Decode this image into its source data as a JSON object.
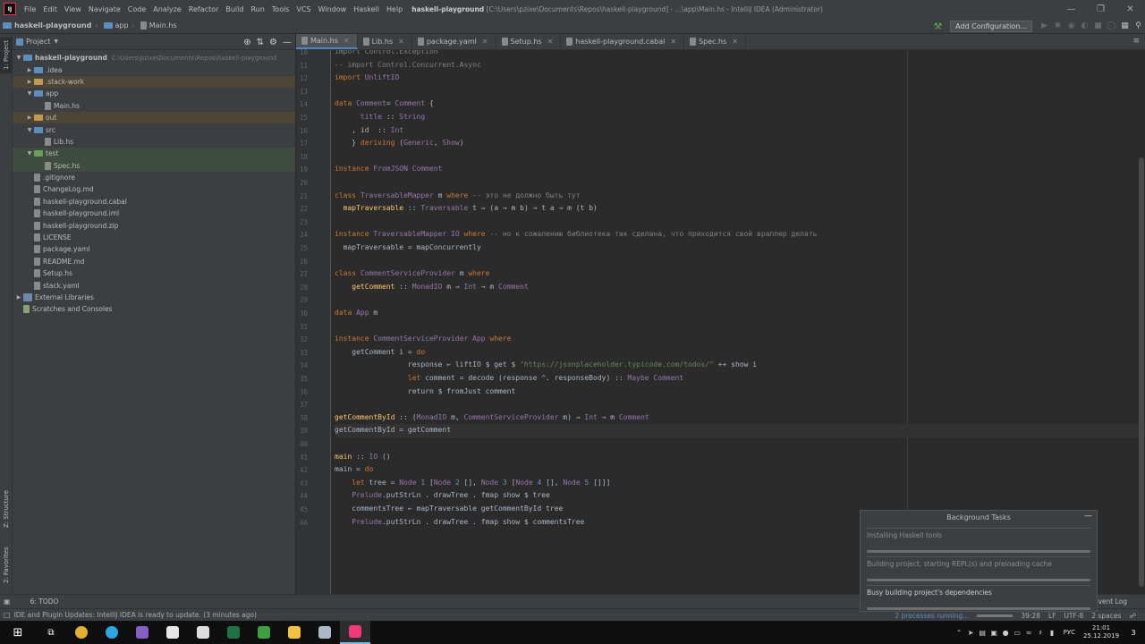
{
  "window": {
    "menu": [
      "File",
      "Edit",
      "View",
      "Navigate",
      "Code",
      "Analyze",
      "Refactor",
      "Build",
      "Run",
      "Tools",
      "VCS",
      "Window",
      "Haskell",
      "Help"
    ],
    "title_bold": "haskell-playground",
    "title_rest": "[C:\\Users\\pzixe\\Documents\\Repos\\haskell-playground] - ...\\app\\Main.hs - IntelliJ IDEA (Administrator)"
  },
  "navbar": {
    "crumbs": [
      "haskell-playground",
      "app",
      "Main.hs"
    ],
    "add_configuration": "Add Configuration..."
  },
  "side_tabs": {
    "project": "1: Project",
    "structure": "Z: Structure",
    "favorites": "2: Favorites"
  },
  "project": {
    "header": "Project",
    "root": {
      "name": "haskell-playground",
      "path": "C:\\Users\\pzixe\\Documents\\Repos\\haskell-playground"
    },
    "items": [
      {
        "label": ".idea",
        "indent": 1,
        "type": "folder",
        "arrow": "▶",
        "style": ""
      },
      {
        "label": ".stack-work",
        "indent": 1,
        "type": "folder",
        "arrow": "▶",
        "style": "excl"
      },
      {
        "label": "app",
        "indent": 1,
        "type": "folder",
        "arrow": "▼",
        "style": ""
      },
      {
        "label": "Main.hs",
        "indent": 2,
        "type": "file",
        "arrow": "",
        "style": ""
      },
      {
        "label": "out",
        "indent": 1,
        "type": "folder",
        "arrow": "▶",
        "style": "excl"
      },
      {
        "label": "src",
        "indent": 1,
        "type": "folder",
        "arrow": "▼",
        "style": ""
      },
      {
        "label": "Lib.hs",
        "indent": 2,
        "type": "file",
        "arrow": "",
        "style": ""
      },
      {
        "label": "test",
        "indent": 1,
        "type": "folder",
        "arrow": "▼",
        "style": "testsrc"
      },
      {
        "label": "Spec.hs",
        "indent": 2,
        "type": "file",
        "arrow": "",
        "style": "testsrc"
      },
      {
        "label": ".gitignore",
        "indent": 1,
        "type": "file",
        "arrow": "",
        "style": ""
      },
      {
        "label": "ChangeLog.md",
        "indent": 1,
        "type": "file",
        "arrow": "",
        "style": ""
      },
      {
        "label": "haskell-playground.cabal",
        "indent": 1,
        "type": "file",
        "arrow": "",
        "style": ""
      },
      {
        "label": "haskell-playground.iml",
        "indent": 1,
        "type": "file",
        "arrow": "",
        "style": ""
      },
      {
        "label": "haskell-playground.zip",
        "indent": 1,
        "type": "file",
        "arrow": "",
        "style": ""
      },
      {
        "label": "LICENSE",
        "indent": 1,
        "type": "file",
        "arrow": "",
        "style": ""
      },
      {
        "label": "package.yaml",
        "indent": 1,
        "type": "file",
        "arrow": "",
        "style": ""
      },
      {
        "label": "README.md",
        "indent": 1,
        "type": "file",
        "arrow": "",
        "style": ""
      },
      {
        "label": "Setup.hs",
        "indent": 1,
        "type": "file",
        "arrow": "",
        "style": ""
      },
      {
        "label": "stack.yaml",
        "indent": 1,
        "type": "file",
        "arrow": "",
        "style": ""
      },
      {
        "label": "External Libraries",
        "indent": 0,
        "type": "lib",
        "arrow": "▶",
        "style": ""
      },
      {
        "label": "Scratches and Consoles",
        "indent": 0,
        "type": "scratch",
        "arrow": "",
        "style": ""
      }
    ]
  },
  "tabs": [
    {
      "label": "Main.hs",
      "active": true
    },
    {
      "label": "Lib.hs",
      "active": false
    },
    {
      "label": "package.yaml",
      "active": false
    },
    {
      "label": "Setup.hs",
      "active": false
    },
    {
      "label": "haskell-playground.cabal",
      "active": false
    },
    {
      "label": "Spec.hs",
      "active": false
    }
  ],
  "code": [
    {
      "n": "10",
      "t": [
        [
          "cm",
          "import Control.Exception"
        ]
      ]
    },
    {
      "n": "11",
      "t": [
        [
          "cm",
          "-- import Control.Concurrent.Async"
        ]
      ]
    },
    {
      "n": "12",
      "t": [
        [
          "kw",
          "import "
        ],
        [
          "ty",
          "UnliftIO"
        ]
      ]
    },
    {
      "n": "13",
      "t": []
    },
    {
      "n": "14",
      "t": [
        [
          "kw",
          "data "
        ],
        [
          "ty",
          "Comment"
        ],
        [
          "",
          "= "
        ],
        [
          "ty",
          "Comment"
        ],
        [
          "",
          " {"
        ]
      ]
    },
    {
      "n": "15",
      "t": [
        [
          "",
          "      "
        ],
        [
          "ty",
          "title"
        ],
        [
          "",
          " :: "
        ],
        [
          "ty",
          "String"
        ]
      ]
    },
    {
      "n": "16",
      "t": [
        [
          "",
          "    , id  :: "
        ],
        [
          "ty",
          "Int"
        ]
      ]
    },
    {
      "n": "17",
      "t": [
        [
          "",
          "    } "
        ],
        [
          "kw",
          "deriving "
        ],
        [
          "",
          "("
        ],
        [
          "ty",
          "Generic"
        ],
        [
          "",
          ", "
        ],
        [
          "ty",
          "Show"
        ],
        [
          "",
          ")"
        ]
      ]
    },
    {
      "n": "18",
      "t": []
    },
    {
      "n": "19",
      "t": [
        [
          "kw",
          "instance "
        ],
        [
          "ty",
          "FromJSON Comment"
        ]
      ]
    },
    {
      "n": "20",
      "t": []
    },
    {
      "n": "21",
      "t": [
        [
          "kw",
          "class "
        ],
        [
          "ty",
          "TraversableMapper"
        ],
        [
          "",
          " m "
        ],
        [
          "kw",
          "where "
        ],
        [
          "cm",
          "-- это не должно быть тут"
        ]
      ]
    },
    {
      "n": "22",
      "t": [
        [
          "",
          "  "
        ],
        [
          "fn",
          "mapTraversable"
        ],
        [
          "",
          " :: "
        ],
        [
          "ty",
          "Traversable"
        ],
        [
          "",
          " t ⇒ (a → m b) → t a → m (t b)"
        ]
      ]
    },
    {
      "n": "23",
      "t": []
    },
    {
      "n": "24",
      "t": [
        [
          "kw",
          "instance "
        ],
        [
          "ty",
          "TraversableMapper IO"
        ],
        [
          "kw",
          " where "
        ],
        [
          "cm",
          "-- но к сожалению библиотека так сделана, что приходится свой враппер делать"
        ]
      ]
    },
    {
      "n": "25",
      "t": [
        [
          "",
          "  mapTraversable = mapConcurrently"
        ]
      ]
    },
    {
      "n": "26",
      "t": []
    },
    {
      "n": "27",
      "t": [
        [
          "kw",
          "class "
        ],
        [
          "ty",
          "CommentServiceProvider"
        ],
        [
          "",
          " m "
        ],
        [
          "kw",
          "where"
        ]
      ]
    },
    {
      "n": "28",
      "t": [
        [
          "",
          "    "
        ],
        [
          "fn",
          "getComment"
        ],
        [
          "",
          " :: "
        ],
        [
          "ty",
          "MonadIO"
        ],
        [
          "",
          " m ⇒ "
        ],
        [
          "ty",
          "Int"
        ],
        [
          "",
          " → m "
        ],
        [
          "ty",
          "Comment"
        ]
      ]
    },
    {
      "n": "29",
      "t": []
    },
    {
      "n": "30",
      "t": [
        [
          "kw",
          "data "
        ],
        [
          "ty",
          "App"
        ],
        [
          "",
          " m"
        ]
      ]
    },
    {
      "n": "31",
      "t": []
    },
    {
      "n": "32",
      "t": [
        [
          "kw",
          "instance "
        ],
        [
          "ty",
          "CommentServiceProvider App"
        ],
        [
          "kw",
          " where"
        ]
      ]
    },
    {
      "n": "33",
      "t": [
        [
          "",
          "    getComment i = "
        ],
        [
          "kw",
          "do"
        ]
      ]
    },
    {
      "n": "34",
      "t": [
        [
          "",
          "                 response ← liftIO $ get $ "
        ],
        [
          "st",
          "\"https://jsonplaceholder.typicode.com/todos/\""
        ],
        [
          "",
          " ++ show i"
        ]
      ]
    },
    {
      "n": "35",
      "t": [
        [
          "",
          "                 "
        ],
        [
          "kw",
          "let "
        ],
        [
          "",
          "comment = decode (response ^. responseBody) :: "
        ],
        [
          "ty",
          "Maybe Comment"
        ]
      ]
    },
    {
      "n": "36",
      "t": [
        [
          "",
          "                 return $ fromJust comment"
        ]
      ]
    },
    {
      "n": "37",
      "t": []
    },
    {
      "n": "38",
      "t": [
        [
          "fn",
          "getCommentById"
        ],
        [
          "",
          " :: ("
        ],
        [
          "ty",
          "MonadIO"
        ],
        [
          "",
          " m, "
        ],
        [
          "ty",
          "CommentServiceProvider"
        ],
        [
          "",
          " m) ⇒ "
        ],
        [
          "ty",
          "Int"
        ],
        [
          "",
          " → m "
        ],
        [
          "ty",
          "Comment"
        ]
      ]
    },
    {
      "n": "39",
      "t": [
        [
          "",
          "getCommentById = getComment"
        ]
      ]
    },
    {
      "n": "40",
      "t": []
    },
    {
      "n": "41",
      "t": [
        [
          "fn",
          "main"
        ],
        [
          "",
          " :: "
        ],
        [
          "ty",
          "IO"
        ],
        [
          "",
          " ()"
        ]
      ]
    },
    {
      "n": "42",
      "t": [
        [
          "",
          "main = "
        ],
        [
          "kw",
          "do"
        ]
      ]
    },
    {
      "n": "43",
      "t": [
        [
          "",
          "    "
        ],
        [
          "kw",
          "let "
        ],
        [
          "",
          "tree = "
        ],
        [
          "ty",
          "Node"
        ],
        [
          " "
        ],
        [
          "nm",
          "1"
        ],
        [
          " ["
        ],
        [
          "ty",
          "Node"
        ],
        [
          " "
        ],
        [
          "nm",
          "2"
        ],
        [
          " [], "
        ],
        [
          "ty",
          "Node"
        ],
        [
          " "
        ],
        [
          "nm",
          "3"
        ],
        [
          " ["
        ],
        [
          "ty",
          "Node"
        ],
        [
          " "
        ],
        [
          "nm",
          "4"
        ],
        [
          " [], "
        ],
        [
          "ty",
          "Node"
        ],
        [
          " "
        ],
        [
          "nm",
          "5"
        ],
        [
          " []]]"
        ]
      ]
    },
    {
      "n": "44",
      "t": [
        [
          "",
          "    "
        ],
        [
          "ty",
          "Prelude"
        ],
        [
          ".putStrLn . drawTree . fmap show $ tree"
        ]
      ]
    },
    {
      "n": "45",
      "t": [
        [
          "",
          "    commentsTree ← mapTraversable getCommentById tree"
        ]
      ]
    },
    {
      "n": "46",
      "t": [
        [
          "",
          "    "
        ],
        [
          "ty",
          "Prelude"
        ],
        [
          ".putStrLn . drawTree . fmap show $ commentsTree"
        ]
      ]
    }
  ],
  "current_line": "39",
  "background_tasks": {
    "title": "Background Tasks",
    "tasks": [
      {
        "label": "Installing Haskell tools",
        "active": false,
        "progress": 0.0
      },
      {
        "label": "Building project, starting REPL(s) and preloading cache",
        "active": false,
        "progress": 0.0
      },
      {
        "label": "Busy building project's dependencies",
        "active": true,
        "progress": 0.0
      }
    ]
  },
  "bottom_bar": {
    "todo": "6: TODO",
    "event_log": "Event Log"
  },
  "status": {
    "message": "IDE and Plugin Updates: IntelliJ IDEA is ready to update. (3 minutes ago)",
    "processes": "2 processes running...",
    "position": "39:28",
    "line_sep": "LF",
    "encoding": "UTF-8",
    "indent": "2 spaces"
  },
  "taskbar": {
    "lang": "РУС",
    "time": "21:01",
    "date": "25.12.2019",
    "notifications": "3",
    "apps": [
      {
        "name": "chrome",
        "color": "#e3b12d"
      },
      {
        "name": "telegram",
        "color": "#2ca5e0"
      },
      {
        "name": "visual-studio",
        "color": "#865fc5"
      },
      {
        "name": "slack",
        "color": "#e8e8e8"
      },
      {
        "name": "cat-app",
        "color": "#dddddd"
      },
      {
        "name": "excel",
        "color": "#1f7244"
      },
      {
        "name": "leaf-app",
        "color": "#3ea043"
      },
      {
        "name": "folder",
        "color": "#f3c140"
      },
      {
        "name": "wireshark",
        "color": "#aab8c8"
      },
      {
        "name": "intellij",
        "color": "#f0387a"
      }
    ]
  }
}
